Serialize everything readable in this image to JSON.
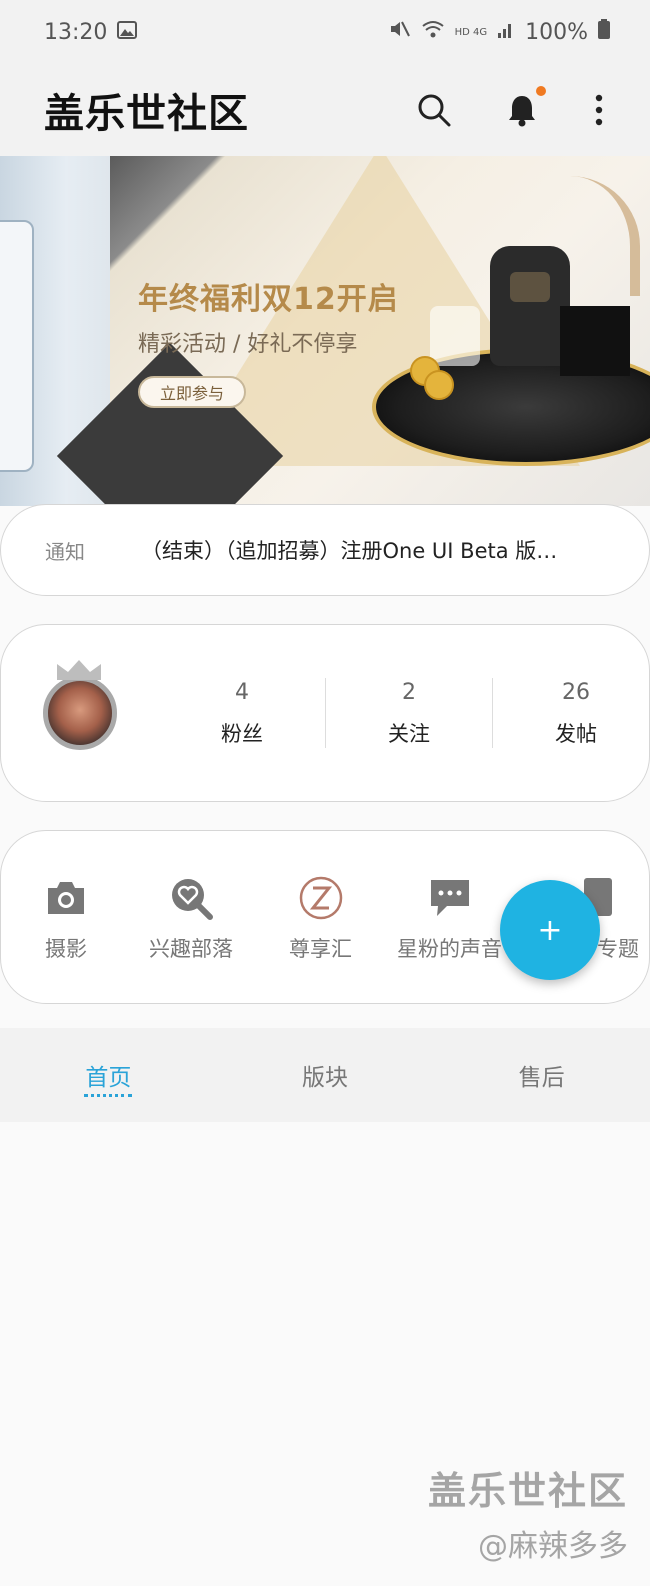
{
  "status_bar": {
    "time": "13:20",
    "battery": "100%",
    "network": "HD 4G"
  },
  "app": {
    "title": "盖乐世社区"
  },
  "banner": {
    "title": "年终福利双12开启",
    "subtitle": "精彩活动 / 好礼不停享",
    "cta": "立即参与",
    "pages": 6,
    "active_page": 2
  },
  "notice": {
    "label": "通知",
    "text": "（结束）（追加招募）注册One UI Beta 版…"
  },
  "profile": {
    "stats": [
      {
        "value": "4",
        "label": "粉丝"
      },
      {
        "value": "2",
        "label": "关注"
      },
      {
        "value": "26",
        "label": "发帖"
      }
    ]
  },
  "shortcuts": [
    {
      "label": "摄影",
      "icon": "camera-icon"
    },
    {
      "label": "兴趣部落",
      "icon": "heart-search-icon"
    },
    {
      "label": "尊享汇",
      "icon": "z-premier-icon"
    },
    {
      "label": "星粉的声音",
      "icon": "chat-bubble-icon"
    },
    {
      "label": "专题",
      "icon": "topic-icon"
    }
  ],
  "fab": {
    "label": "+"
  },
  "tabs": [
    {
      "label": "首页",
      "active": true
    },
    {
      "label": "版块",
      "active": false
    },
    {
      "label": "售后",
      "active": false
    }
  ],
  "watermark": {
    "line1": "盖乐世社区",
    "line2": "@麻辣多多"
  },
  "colors": {
    "accent": "#1fb3e2",
    "tab_active": "#2aa3d8",
    "notification_dot": "#f07a22"
  }
}
